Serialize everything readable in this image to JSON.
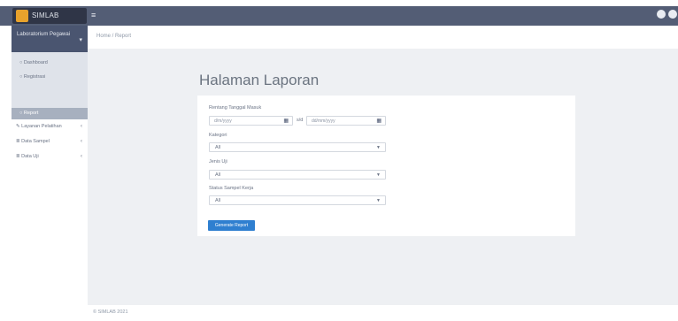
{
  "topbar": {
    "brand_label": "SIMLAB",
    "menu_toggle_glyph": "≡",
    "icons": [
      "settings-icon",
      "user-icon"
    ]
  },
  "sidebar": {
    "active_group": {
      "label": "Laboratorium Pegawai"
    },
    "sub_items": [
      {
        "label": "Dashboard"
      },
      {
        "label": "Registrasi"
      },
      {
        "label": "Report"
      }
    ],
    "items": [
      {
        "label": "Layanan Pelatihan"
      },
      {
        "label": "Data Sampel"
      },
      {
        "label": "Data Uji"
      }
    ]
  },
  "breadcrumb": {
    "text": "Home / Report"
  },
  "page": {
    "title": "Halaman Laporan"
  },
  "form": {
    "date_range_label": "Rentang Tanggal Masuk",
    "date_from_placeholder": "d/m/yyyy",
    "date_separator": "s/d",
    "date_to_placeholder": "dd/mm/yyyy",
    "kategori_label": "Kategori",
    "kategori_value": "All",
    "jenis_uji_label": "Jenis Uji",
    "jenis_uji_value": "All",
    "status_label": "Status Sampel Kerja",
    "status_value": "All",
    "submit_label": "Generate Report"
  },
  "footer": {
    "text": "© SIMLAB 2021"
  },
  "colors": {
    "topbar": "#535d75",
    "sidebar_active": "#4a5570",
    "content_bg": "#eef0f3",
    "primary": "#2f7fd0"
  }
}
